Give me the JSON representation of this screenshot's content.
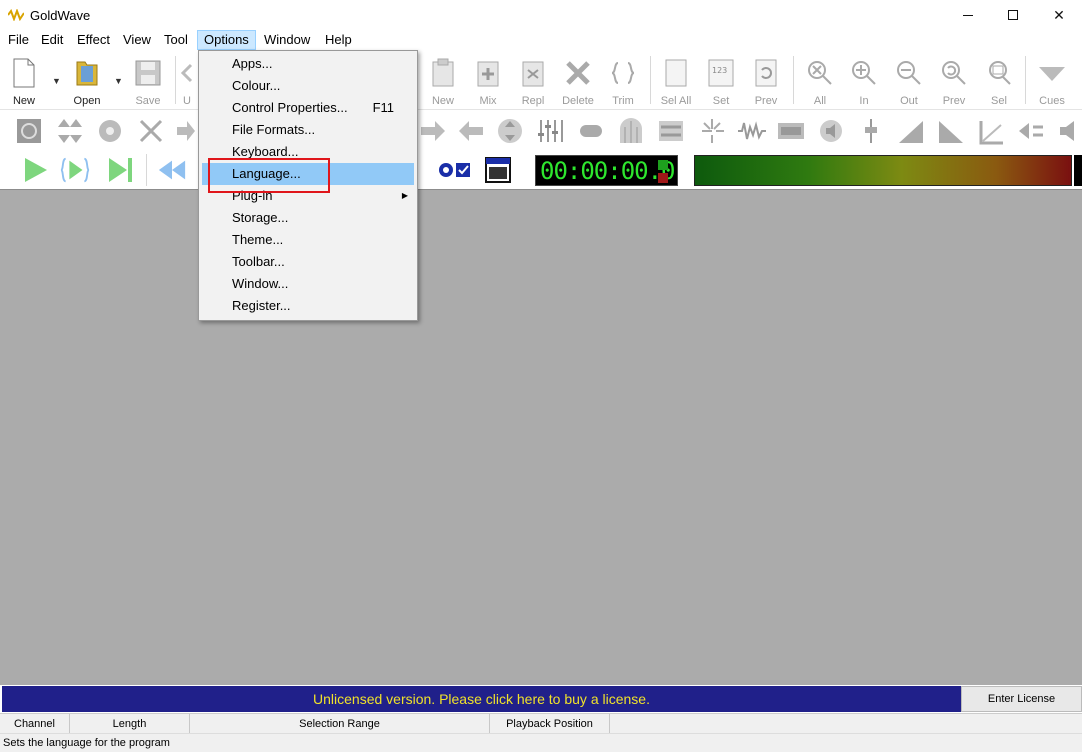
{
  "window": {
    "title": "GoldWave",
    "minimize": "–",
    "maximize": "☐",
    "close": "✕"
  },
  "menubar": [
    {
      "label": "File"
    },
    {
      "label": "Edit"
    },
    {
      "label": "Effect"
    },
    {
      "label": "View"
    },
    {
      "label": "Tool"
    },
    {
      "label": "Options"
    },
    {
      "label": "Window"
    },
    {
      "label": "Help"
    }
  ],
  "toolbar": {
    "new": "New",
    "open": "Open",
    "save": "Save",
    "undo_partial": "U",
    "clip_new": "New",
    "mix": "Mix",
    "repl": "Repl",
    "delete": "Delete",
    "trim": "Trim",
    "sel_all": "Sel All",
    "set": "Set",
    "prev": "Prev",
    "zoom_all": "All",
    "zoom_in": "In",
    "zoom_out": "Out",
    "zoom_prev": "Prev",
    "zoom_sel": "Sel",
    "cues": "Cues"
  },
  "timer": {
    "value": "00:00:00.0"
  },
  "options_menu": {
    "items": [
      {
        "label": "Apps...",
        "shortcut": ""
      },
      {
        "label": "Colour...",
        "shortcut": ""
      },
      {
        "label": "Control Properties...",
        "shortcut": "F11"
      },
      {
        "label": "File Formats...",
        "shortcut": ""
      },
      {
        "label": "Keyboard...",
        "shortcut": ""
      },
      {
        "label": "Language...",
        "shortcut": ""
      },
      {
        "label": "Plug-in",
        "shortcut": ""
      },
      {
        "label": "Storage...",
        "shortcut": ""
      },
      {
        "label": "Theme...",
        "shortcut": ""
      },
      {
        "label": "Toolbar...",
        "shortcut": ""
      },
      {
        "label": "Window...",
        "shortcut": ""
      },
      {
        "label": "Register...",
        "shortcut": ""
      }
    ]
  },
  "license": {
    "message": "Unlicensed version. Please click here to buy a license.",
    "button": "Enter License"
  },
  "status": {
    "channel": "Channel",
    "length": "Length",
    "selection": "Selection Range",
    "playback": "Playback Position"
  },
  "help_text": "Sets the language for the program",
  "colors": {
    "accent_menu": "#91c9f7",
    "license_bg": "#20208a",
    "license_text": "#f0e22a",
    "timer_text": "#2ee62e",
    "highlight_box": "#e0161b"
  }
}
